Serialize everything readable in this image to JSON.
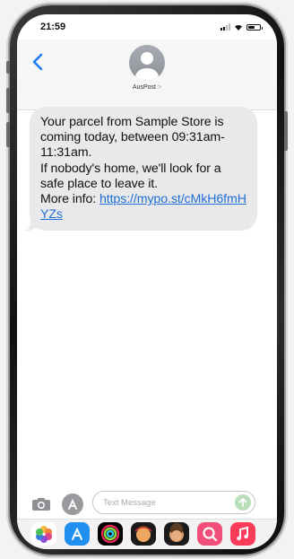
{
  "status_bar": {
    "time": "21:59",
    "battery_level": 0.55
  },
  "conversation": {
    "contact_name": "AusPost",
    "contact_chevron": ">"
  },
  "message": {
    "line1": "Your parcel from Sample Store is coming today, between 09:31am-11:31am.",
    "line2": "If nobody's home, we'll look for a safe place to leave it.",
    "more_info_label": "More info:",
    "link_text": "https://mypo.st/cMkH6fmHYZs",
    "link_href": "https://mypo.st/cMkH6fmHYZs"
  },
  "composer": {
    "placeholder": "Text Message"
  },
  "dock": {
    "apps": [
      "photos-icon",
      "app-store-icon",
      "activity-icon",
      "memoji-icon",
      "memoji-icon",
      "search-icon",
      "music-icon"
    ]
  },
  "colors": {
    "bubble": "#e9e9eb",
    "link": "#1f6fd6",
    "send": "#b9e0ba"
  }
}
